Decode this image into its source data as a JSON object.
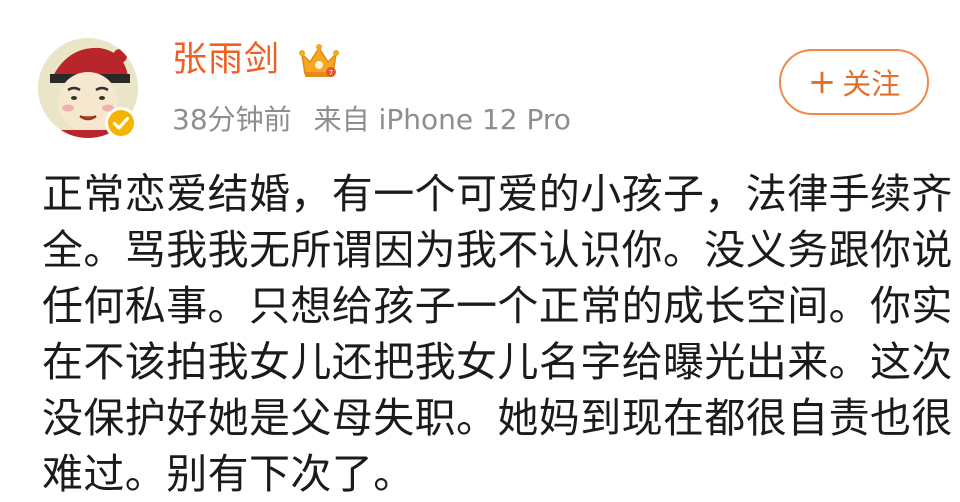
{
  "user": {
    "name": "张雨剑",
    "verified_icon": "verified-badge-icon",
    "vip_icon": "vip-crown-icon"
  },
  "meta": {
    "time": "38分钟前",
    "source": "来自 iPhone 12 Pro"
  },
  "follow": {
    "plus": "+",
    "label": "关注"
  },
  "post": {
    "lines": [
      "正常恋爱结婚，有一个可爱的小孩子，法律手续齐",
      "全。骂我我无所谓因为我不认识你。没义务跟你说",
      "任何私事。只想给孩子一个正常的成长空间。你实",
      "在不该拍我女儿还把我女儿名字给曝光出来。这次",
      "没保护好她是父母失职。她妈到现在都很自责也很",
      "难过。别有下次了。"
    ]
  },
  "colors": {
    "username": "#f25f22",
    "meta": "#8e8e8e",
    "follow_border": "#f08a4b",
    "follow_text": "#e06f2c",
    "body_text": "#1b1b1b",
    "verified": "#f5b400"
  }
}
